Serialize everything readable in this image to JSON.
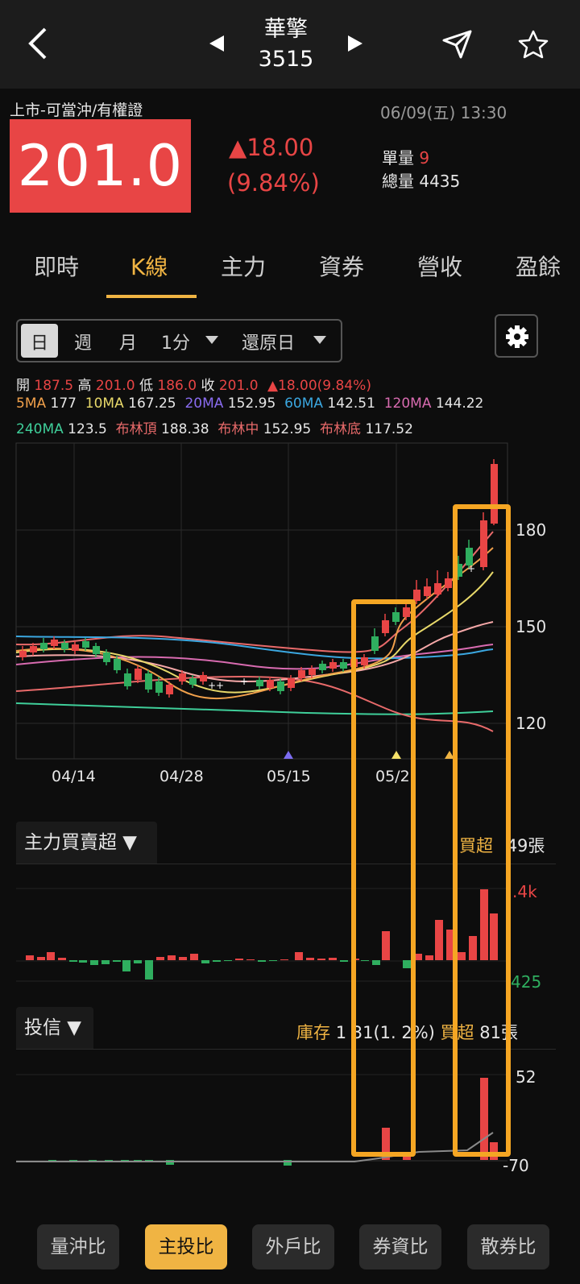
{
  "header": {
    "title": "華擎",
    "code": "3515"
  },
  "quote": {
    "market": "上市-可當沖/有權證",
    "datetime": "06/09(五) 13:30",
    "price": "201.0",
    "change": "▲18.00",
    "change_pct": "(9.84%)",
    "unit_vol_label": "單量",
    "unit_vol": "9",
    "total_vol_label": "總量",
    "total_vol": "4435"
  },
  "tabs": [
    "即時",
    "K線",
    "主力",
    "資券",
    "營收",
    "盈餘"
  ],
  "period": {
    "day": "日",
    "week": "週",
    "month": "月",
    "minute": "1分",
    "restore": "還原日"
  },
  "ohlc": {
    "open_label": "開",
    "open": "187.5",
    "high_label": "高",
    "high": "201.0",
    "low_label": "低",
    "low": "186.0",
    "close_label": "收",
    "close": "201.0",
    "change": "▲18.00(9.84%)"
  },
  "ma": {
    "ma5_label": "5MA",
    "ma5": "177",
    "ma10_label": "10MA",
    "ma10": "167.25",
    "ma20_label": "20MA",
    "ma20": "152.95",
    "ma60_label": "60MA",
    "ma60": "142.51",
    "ma120_label": "120MA",
    "ma120": "144.22",
    "ma240_label": "240MA",
    "ma240": "123.5",
    "boll_top_label": "布林頂",
    "boll_top": "188.38",
    "boll_mid_label": "布林中",
    "boll_mid": "152.95",
    "boll_bot_label": "布林底",
    "boll_bot": "117.52"
  },
  "kchart": {
    "y_labels": [
      "180",
      "150",
      "120"
    ],
    "x_labels": [
      "04/14",
      "04/28",
      "05/15",
      "05/2"
    ]
  },
  "main_force": {
    "title": "主力買賣超 ▼",
    "right_label": "買超",
    "right_value": "49張",
    "top_value": ".4k",
    "bottom_value": "425"
  },
  "trust": {
    "title": "投信 ▼",
    "inventory_label": "庫存",
    "inventory_value": "1 31(1. 2%)",
    "buy_label": "買超",
    "buy_value": "81張",
    "top_value": "52",
    "bottom_value": "-70"
  },
  "bottom_buttons": [
    "量沖比",
    "主投比",
    "外戶比",
    "券資比",
    "散券比"
  ],
  "colors": {
    "accent": "#f0b443",
    "up": "#e84545",
    "down": "#2fae5f",
    "highlight_box": "#f5a623"
  }
}
